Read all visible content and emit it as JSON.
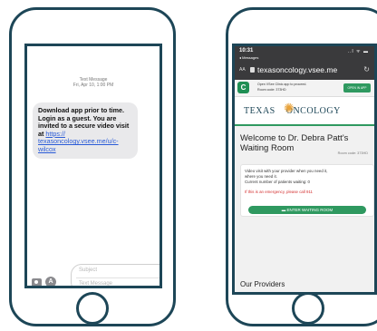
{
  "sms": {
    "header_title": "Text Message",
    "header_date": "Fri, Apr 10, 1:00 PM",
    "message_lines": [
      "Download app prior to time.",
      "Login as a guest.  You are",
      "invited to a secure video visit",
      "at"
    ],
    "link_text": "https://texasoncology.vsee.me/u/c-wilcox",
    "link_lines": [
      "https://",
      "texasoncology.vsee.me/u/c-",
      "wilcox"
    ],
    "subject_placeholder": "Subject",
    "message_placeholder": "Text Message",
    "camera_icon": "camera-icon",
    "apps_icon": "app-store-icon",
    "apps_glyph": "A",
    "send_icon": "send-arrow-icon"
  },
  "browser": {
    "time": "10:31",
    "back_label": "◂ Messages",
    "signal": "..l ᯤ ▬",
    "aa": "AA",
    "url": "texasoncology.vsee.me",
    "reload": "↻",
    "banner_line1": "Open VSee Clinic app to proceed.",
    "banner_line2": "Room code: 373HD",
    "open_button": "OPEN IN APP",
    "app_icon_glyph": "C",
    "logo_left": "TEXAS",
    "logo_right": "ONCOLOGY",
    "welcome_line1": "Welcome to Dr. Debra Patt's",
    "welcome_line2": "Waiting Room",
    "room_code": "Room code: 373HD",
    "card_line1": "Video visit with your provider when you need it,",
    "card_line2": "where you need it.",
    "card_line3": "Current number of patients waiting: 0",
    "emergency": "If this is an emergency, please call 911",
    "enter_button": "ENTER WAITING ROOM",
    "providers_heading": "Our Providers"
  },
  "colors": {
    "frame": "#1d4657",
    "accent_green": "#2f9960",
    "link_blue": "#2a5bd7",
    "emergency_red": "#d32f2f"
  }
}
